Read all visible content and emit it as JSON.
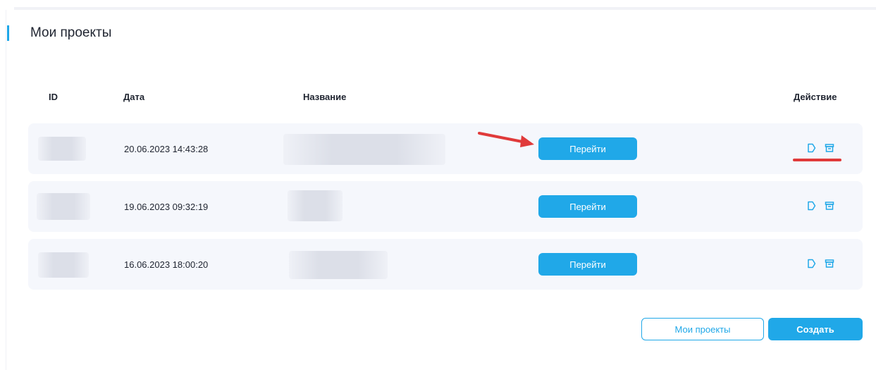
{
  "page": {
    "title": "Мои проекты"
  },
  "table": {
    "headers": {
      "id": "ID",
      "date": "Дата",
      "name": "Название",
      "action": "Действие"
    },
    "rows": [
      {
        "date": "20.06.2023 14:43:28",
        "go_label": "Перейти"
      },
      {
        "date": "19.06.2023 09:32:19",
        "go_label": "Перейти"
      },
      {
        "date": "16.06.2023 18:00:20",
        "go_label": "Перейти"
      }
    ]
  },
  "footer": {
    "my_projects_label": "Мои проекты",
    "create_label": "Создать"
  },
  "colors": {
    "accent": "#20a8e8",
    "row_bg": "#f5f7fc",
    "annotation": "#e03a3a"
  },
  "icons": {
    "edit": "edit-icon",
    "archive": "archive-icon",
    "arrow": "arrow-annotation"
  }
}
